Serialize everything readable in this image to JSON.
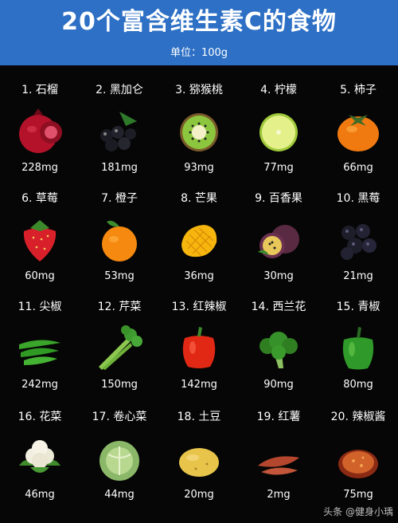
{
  "header": {
    "title": "20个富含维生素C的食物",
    "unit": "单位：100g",
    "bg": "#2d70c5"
  },
  "items": [
    {
      "rank": "1.",
      "name": "石榴",
      "amount": "228mg",
      "icon": "pomegranate-icon"
    },
    {
      "rank": "2.",
      "name": "黑加仑",
      "amount": "181mg",
      "icon": "blackcurrant-icon"
    },
    {
      "rank": "3.",
      "name": "猕猴桃",
      "amount": "93mg",
      "icon": "kiwi-icon"
    },
    {
      "rank": "4.",
      "name": "柠檬",
      "amount": "77mg",
      "icon": "lemon-icon"
    },
    {
      "rank": "5.",
      "name": "柿子",
      "amount": "66mg",
      "icon": "persimmon-icon"
    },
    {
      "rank": "6.",
      "name": "草莓",
      "amount": "60mg",
      "icon": "strawberry-icon"
    },
    {
      "rank": "7.",
      "name": "橙子",
      "amount": "53mg",
      "icon": "orange-icon"
    },
    {
      "rank": "8.",
      "name": "芒果",
      "amount": "36mg",
      "icon": "mango-icon"
    },
    {
      "rank": "9.",
      "name": "百香果",
      "amount": "30mg",
      "icon": "passionfruit-icon"
    },
    {
      "rank": "10.",
      "name": "黑莓",
      "amount": "21mg",
      "icon": "blackberry-icon"
    },
    {
      "rank": "11.",
      "name": "尖椒",
      "amount": "242mg",
      "icon": "green-chili-icon"
    },
    {
      "rank": "12.",
      "name": "芹菜",
      "amount": "150mg",
      "icon": "celery-icon"
    },
    {
      "rank": "13.",
      "name": "红辣椒",
      "amount": "142mg",
      "icon": "red-pepper-icon"
    },
    {
      "rank": "14.",
      "name": "西兰花",
      "amount": "90mg",
      "icon": "broccoli-icon"
    },
    {
      "rank": "15.",
      "name": "青椒",
      "amount": "80mg",
      "icon": "green-pepper-icon"
    },
    {
      "rank": "16.",
      "name": "花菜",
      "amount": "46mg",
      "icon": "cauliflower-icon"
    },
    {
      "rank": "17.",
      "name": "卷心菜",
      "amount": "44mg",
      "icon": "cabbage-icon"
    },
    {
      "rank": "18.",
      "name": "土豆",
      "amount": "20mg",
      "icon": "potato-icon"
    },
    {
      "rank": "19.",
      "name": "红薯",
      "amount": "2mg",
      "icon": "sweet-potato-icon"
    },
    {
      "rank": "20.",
      "name": "辣椒酱",
      "amount": "75mg",
      "icon": "chili-sauce-icon"
    }
  ],
  "watermark": "头条 @健身小瑀"
}
